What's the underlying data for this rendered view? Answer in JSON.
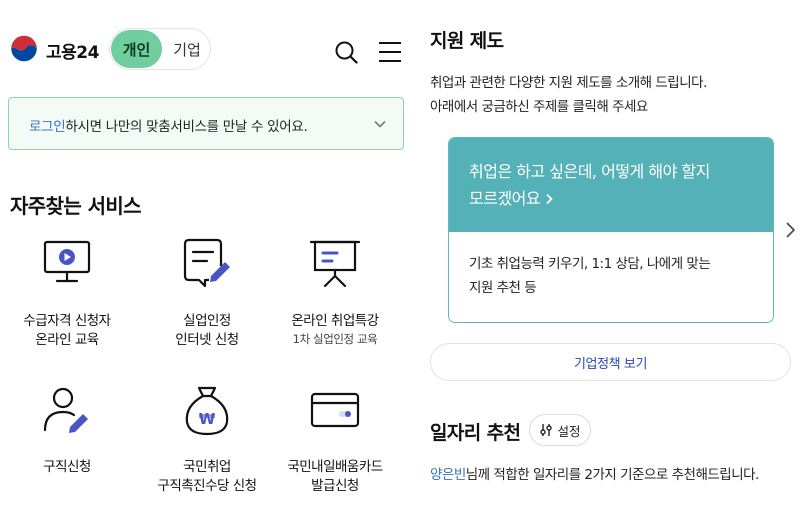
{
  "header": {
    "brand": "고용24",
    "seg_personal": "개인",
    "seg_business": "기업"
  },
  "login_bar": {
    "link": "로그인",
    "text": "하시면 나만의 맞춤서비스를 만날 수 있어요."
  },
  "favorites": {
    "title": "자주찾는 서비스",
    "items": [
      {
        "line1": "수급자격 신청자",
        "line2": "온라인 교육",
        "sub": "",
        "icon": "monitor-play-icon"
      },
      {
        "line1": "실업인정",
        "line2": "인터넷 신청",
        "sub": "",
        "icon": "document-pen-icon"
      },
      {
        "line1": "온라인 취업특강",
        "line2": "",
        "sub": "1차 실업인정 교육",
        "icon": "presentation-board-icon"
      },
      {
        "line1": "구직신청",
        "line2": "",
        "sub": "",
        "icon": "person-pen-icon"
      },
      {
        "line1": "국민취업",
        "line2": "구직촉진수당 신청",
        "sub": "",
        "icon": "money-bag-won-icon"
      },
      {
        "line1": "국민내일배움카드",
        "line2": "발급신청",
        "sub": "",
        "icon": "card-icon"
      }
    ]
  },
  "support": {
    "title": "지원 제도",
    "desc_line1": "취업과 관련한 다양한 지원 제도를 소개해 드립니다.",
    "desc_line2": "아래에서 궁금하신 주제를 클릭해 주세요",
    "card_head_line1": "취업은 하고 싶은데, 어떻게 해야 할지",
    "card_head_line2": "모르겠어요",
    "card_body_line1": "기초 취업능력 키우기, 1:1 상담, 나에게 맞는",
    "card_body_line2": "지원 추천 등",
    "policy_button": "기업정책 보기"
  },
  "jobs": {
    "title": "일자리 추천",
    "settings_label": "설정",
    "user_name": "양은빈",
    "desc_rest": "님께 적합한 일자리를 2가지 기준으로 추천해드립니다."
  },
  "colors": {
    "brand_green": "#6fcd9e",
    "card_teal": "#55b1b8",
    "link_blue": "#3a70c9",
    "icon_accent": "#4a55c4"
  }
}
